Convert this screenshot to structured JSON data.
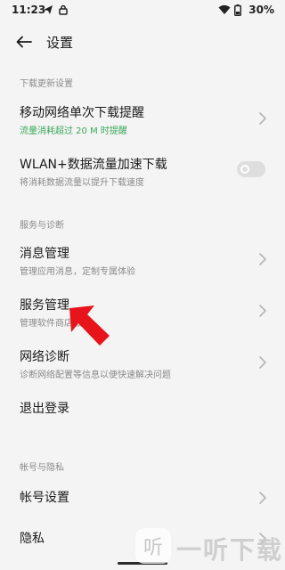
{
  "status_bar": {
    "time": "11:23",
    "battery": "30%",
    "icons": [
      "send-icon",
      "lock-icon",
      "wifi-icon",
      "battery-icon"
    ]
  },
  "header": {
    "title": "设置",
    "back_icon": "arrow-left-icon"
  },
  "sections": {
    "download": {
      "title": "下载更新设置",
      "mobile": {
        "title": "移动网络单次下载提醒",
        "subtitle": "流量消耗超过 20 M 时提醒"
      },
      "wlan": {
        "title": "WLAN+数据流量加速下载",
        "subtitle": "将消耗数据流量以提升下载速度",
        "toggle_on": false
      }
    },
    "service": {
      "title": "服务与诊断",
      "message": {
        "title": "消息管理",
        "subtitle": "管理应用消息，定制专属体验"
      },
      "service_mgmt": {
        "title": "服务管理",
        "subtitle": "管理软件商店服务"
      },
      "network": {
        "title": "网络诊断",
        "subtitle": "诊断网络配置等信息以便快速解决问题"
      },
      "logout": {
        "title": "退出登录"
      }
    },
    "account": {
      "title": "帐号与隐私",
      "account_settings": {
        "title": "帐号设置"
      },
      "privacy": {
        "title": "隐私"
      }
    }
  },
  "watermark": {
    "text": "一听下载",
    "logo_glyph": "听"
  },
  "colors": {
    "background": "#f4f4f4",
    "accent_green": "#3aa85a",
    "pointer_red": "#e8141c",
    "secondary_text": "#8a8a8a"
  }
}
